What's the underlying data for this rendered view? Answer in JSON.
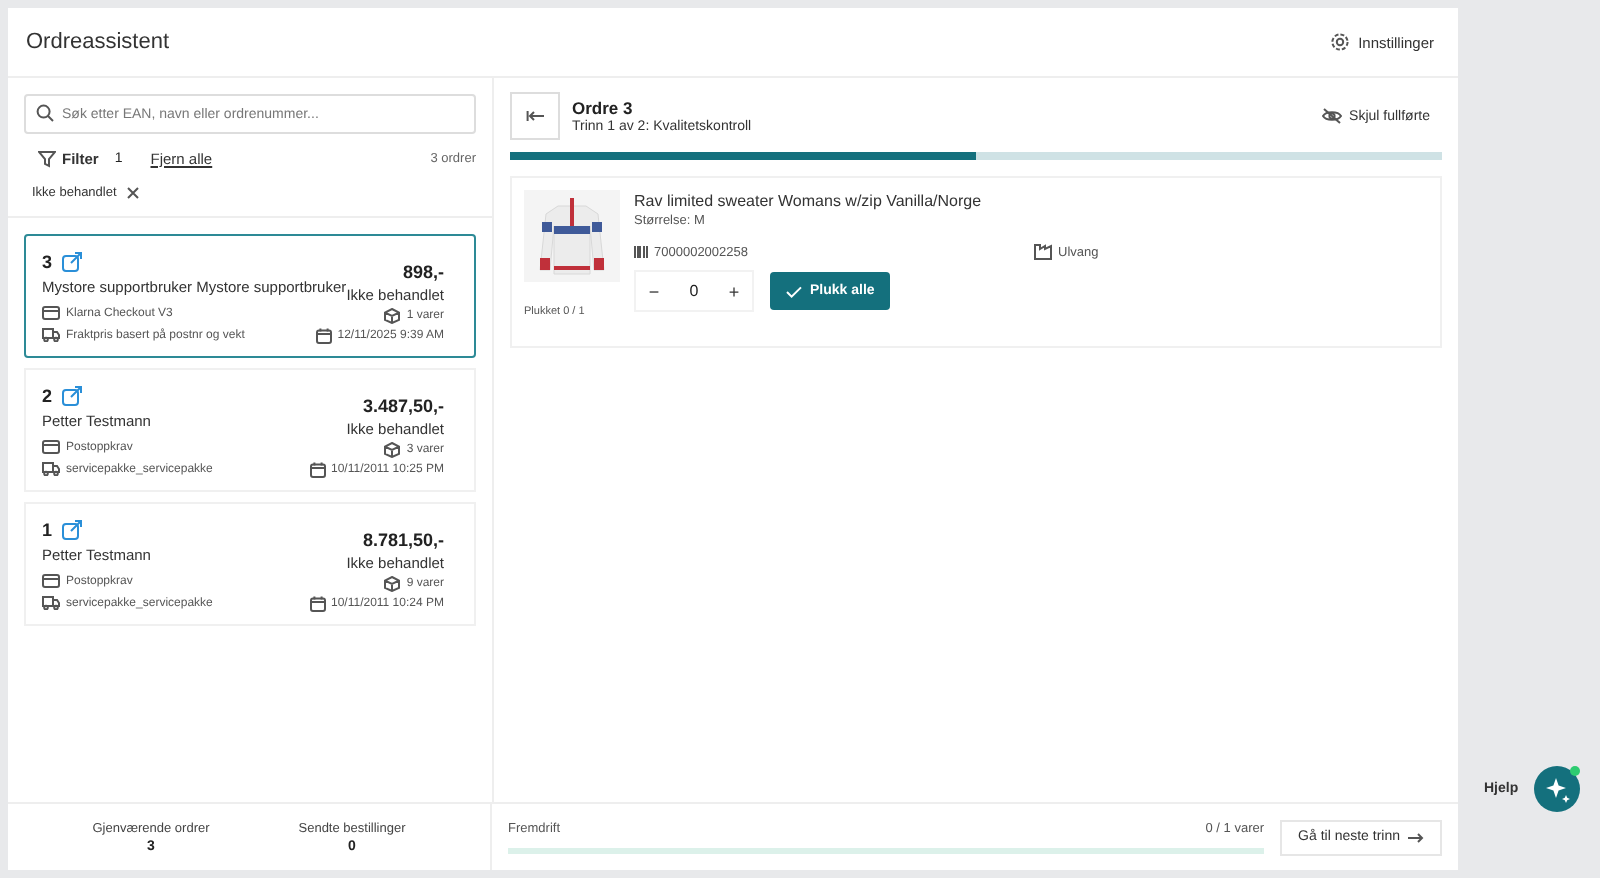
{
  "header": {
    "title": "Ordreassistent",
    "settings_label": "Innstillinger"
  },
  "search": {
    "placeholder": "Søk etter EAN, navn eller ordrenummer..."
  },
  "filter": {
    "label": "Filter",
    "count": "1",
    "clear_label": "Fjern alle",
    "order_count": "3 ordrer",
    "chips": [
      "Ikke behandlet"
    ]
  },
  "orders": [
    {
      "number": "3",
      "customer": "Mystore supportbruker Mystore supportbruker",
      "payment": "Klarna Checkout V3",
      "shipping": "Fraktpris basert på postnr og vekt",
      "amount": "898,-",
      "status": "Ikke behandlet",
      "items": "1 varer",
      "date": "12/11/2025 9:39 AM",
      "selected": true
    },
    {
      "number": "2",
      "customer": "Petter Testmann",
      "payment": "Postoppkrav",
      "shipping": "servicepakke_servicepakke",
      "amount": "3.487,50,-",
      "status": "Ikke behandlet",
      "items": "3 varer",
      "date": "10/11/2011 10:25 PM",
      "selected": false
    },
    {
      "number": "1",
      "customer": "Petter Testmann",
      "payment": "Postoppkrav",
      "shipping": "servicepakke_servicepakke",
      "amount": "8.781,50,-",
      "status": "Ikke behandlet",
      "items": "9 varer",
      "date": "10/11/2011 10:24 PM",
      "selected": false
    }
  ],
  "detail": {
    "title": "Ordre 3",
    "step": "Trinn 1 av 2: Kvalitetskontroll",
    "hide_label": "Skjul fullførte",
    "step_progress": {
      "level": 0.5
    },
    "items": [
      {
        "name": "Rav limited sweater Womans w/zip Vanilla/Norge",
        "size": "Størrelse: M",
        "ean": "7000002002258",
        "location": "Ulvang",
        "picked": "Plukket 0 / 1",
        "quantity": "0",
        "decrement": "−",
        "increment": "+",
        "pick_all": "Plukk alle"
      }
    ]
  },
  "footer": {
    "stats": [
      {
        "label": "Gjenværende ordrer",
        "value": "3"
      },
      {
        "label": "Sendte bestillinger",
        "value": "0"
      }
    ],
    "progress_label": "Fremdrift",
    "progress": {
      "level": 0
    },
    "progress_text": "0 / 1 varer",
    "next_label": "Gå til neste trinn"
  },
  "help": {
    "label": "Hjelp"
  }
}
